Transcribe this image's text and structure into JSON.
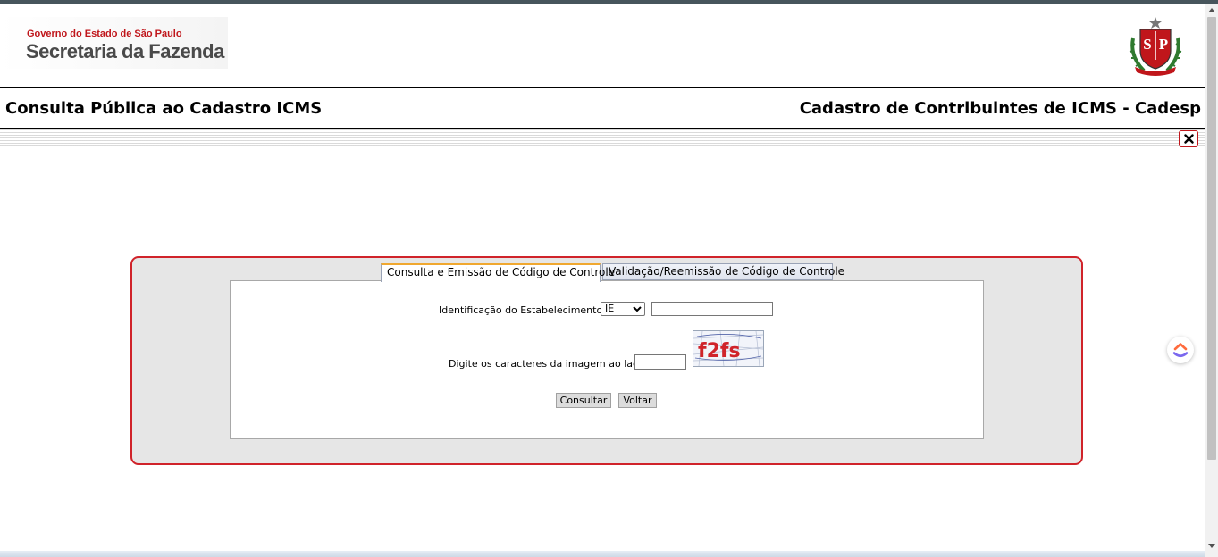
{
  "header": {
    "logo_line1": "Governo do Estado de São Paulo",
    "logo_line2": "Secretaria da Fazenda",
    "seal_text": "SP"
  },
  "titles": {
    "left": "Consulta Pública ao Cadastro ICMS",
    "right": "Cadastro de Contribuintes de ICMS - Cadesp"
  },
  "close_label": "✕",
  "tabs": [
    {
      "label": "Consulta e Emissão de Código de Controle",
      "active": true
    },
    {
      "label": "Validação/Reemissão de Código de Controle",
      "active": false
    }
  ],
  "form": {
    "ident_label": "Identificação do Estabelecimento:",
    "ident_type_value": "IE",
    "ident_value": "",
    "captcha_label": "Digite os caracteres da imagem ao lado:",
    "captcha_image_text": "f2fs",
    "captcha_value": ""
  },
  "buttons": {
    "consultar": "Consultar",
    "voltar": "Voltar"
  },
  "colors": {
    "accent_red": "#d0232a",
    "panel_bg": "#e6e6e6",
    "topbar": "#47555c"
  }
}
